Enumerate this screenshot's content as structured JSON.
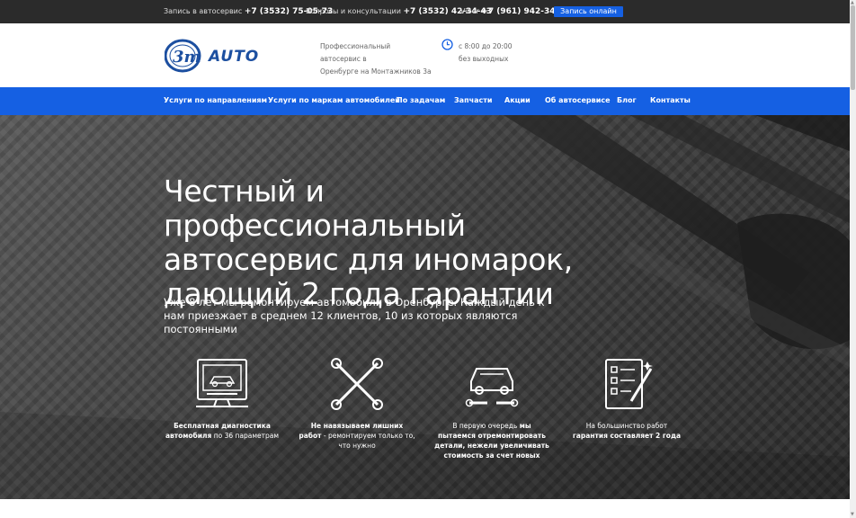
{
  "topbar": {
    "booking_label": "Запись в автосервис",
    "booking_phone": "+7 (3532) 75-05-73",
    "questions_label": "Вопросы и консультации",
    "questions_phone": "+7 (3532) 42-34-43",
    "viber_label": "Viber",
    "viber_phone": "+7 (961) 942-34-43",
    "online_button": "Запись онлайн"
  },
  "header": {
    "logo_text": "AUTO",
    "logo_mark": "3m",
    "address_line1": "Профессиональный автосервис в",
    "address_line2": "Оренбурге на Монтажников 3а",
    "hours_line1": "с 8:00 до 20:00",
    "hours_line2": "без выходных"
  },
  "nav": {
    "items": [
      "Услуги по направлениям",
      "Услуги по маркам автомобилей",
      "По задачам",
      "Запчасти",
      "Акции",
      "Об автосервисе",
      "Блог",
      "Контакты"
    ]
  },
  "hero": {
    "title": "Честный и профессиональный автосервис для иномарок, дающий 2 года гарантии",
    "lead": "Уже 8 лет мы ремонтируем автомобили в Оренбурге. Каждый день к нам приезжает в среднем 12 клиентов, 10 из которых являются постоянными"
  },
  "features": [
    {
      "icon": "computer-diagnostics-icon",
      "bold1": "Бесплатная диагностика автомобиля",
      "text1": " по 36 параметрам"
    },
    {
      "icon": "cross-wrench-icon",
      "bold1": "Не навязываем лишних работ",
      "text1": " - ремонтируем только то, что нужно"
    },
    {
      "icon": "car-repair-icon",
      "text0": "В первую очередь ",
      "bold1": "мы пытаемся отремонтировать детали, нежели увеличивать стоимость за счет новых",
      "text1": ""
    },
    {
      "icon": "checklist-icon",
      "text0": "На большинство работ ",
      "bold1": "гарантия составляет 2 года",
      "text1": ""
    }
  ],
  "colors": {
    "accent": "#1560e3",
    "topbar": "#2b2b2b"
  }
}
